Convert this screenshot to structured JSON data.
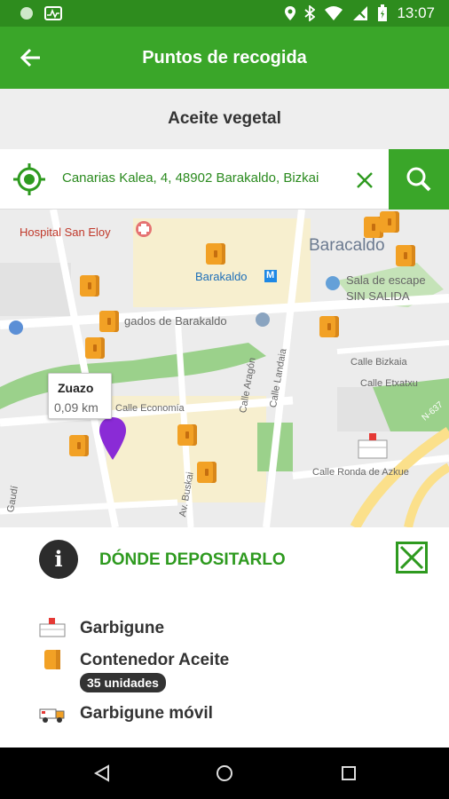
{
  "status_bar": {
    "time": "13:07",
    "icons": [
      "circle-icon",
      "activity-icon",
      "location-icon",
      "bluetooth-icon",
      "wifi-icon",
      "signal-icon",
      "battery-icon"
    ]
  },
  "app_bar": {
    "title": "Puntos de recogida",
    "back_icon": "arrow-back-icon"
  },
  "subheader": {
    "title": "Aceite vegetal"
  },
  "search": {
    "value": "Canarias Kalea, 4, 48902 Barakaldo, Bizkai",
    "icons": [
      "my-location-icon",
      "clear-icon",
      "search-icon"
    ]
  },
  "map": {
    "labels": {
      "hospital": "Hospital San Eloy",
      "city": "Baracaldo",
      "metro": "Barakaldo",
      "metro_badge": "M",
      "escape": "Sala de escape",
      "escape2": "SIN SALIDA",
      "juzgados": "gados de Barakaldo",
      "bizkaia": "Calle Bizkaia",
      "etxatxu": "Calle Etxatxu",
      "economia": "Calle Economía",
      "aragon": "Calle Aragón",
      "landaia": "Calle Landaia",
      "ronda": "Calle Ronda de Azkue",
      "buskai": "Av. Buskai",
      "gaudi": "Gaudí",
      "highway": "N-637"
    },
    "tooltip": {
      "name": "Zuazo",
      "distance": "0,09 km"
    },
    "colors": {
      "marker": "#f2a125",
      "pin": "#8a2bd6",
      "park": "#9bd18b"
    }
  },
  "sheet": {
    "heading": "DÓNDE DEPOSITARLO",
    "info_icon": "i",
    "items": [
      {
        "label": "Garbigune",
        "icon": "garbigune-icon"
      },
      {
        "label": "Contenedor Aceite",
        "icon": "container-icon"
      },
      {
        "label": "Garbigune móvil",
        "icon": "truck-icon"
      }
    ],
    "badge": "35 unidades"
  },
  "nav_bar": {
    "icons": [
      "back-triangle-icon",
      "home-circle-icon",
      "recents-square-icon"
    ]
  },
  "accent": "#3aa629"
}
